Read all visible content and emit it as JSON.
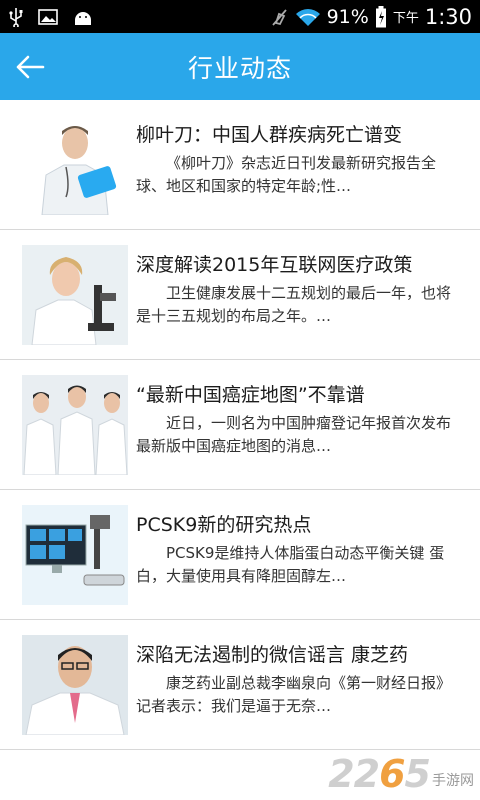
{
  "status_bar": {
    "battery_percent": "91%",
    "period": "下午",
    "time": "1:30",
    "icons": [
      "usb-icon",
      "image-icon",
      "android-icon",
      "mute-icon",
      "wifi-icon",
      "battery-icon"
    ]
  },
  "header": {
    "back_icon": "arrow-left-icon",
    "title": "行业动态"
  },
  "news": [
    {
      "title": "柳叶刀：中国人群疾病死亡谱变",
      "desc": "《柳叶刀》杂志近日刊发最新研究报告全球、地区和国家的特定年龄;性…",
      "thumb": "doctor-with-tablet"
    },
    {
      "title": "深度解读2015年互联网医疗政策",
      "desc": "卫生健康发展十二五规划的最后一年，也将是十三五规划的布局之年。…",
      "thumb": "doctor-with-microscope"
    },
    {
      "title": "“最新中国癌症地图”不靠谱",
      "desc": "近日，一则名为中国肿瘤登记年报首次发布最新版中国癌症地图的消息…",
      "thumb": "medical-team"
    },
    {
      "title": "PCSK9新的研究热点",
      "desc": "PCSK9是维持人体脂蛋白动态平衡关键 蛋白，大量使用具有降胆固醇左…",
      "thumb": "lab-equipment"
    },
    {
      "title": "深陷无法遏制的微信谣言 康芝药",
      "desc": "康芝药业副总裁李幽泉向《第一财经日报》记者表示：我们是逼于无奈…",
      "thumb": "doctor-portrait"
    }
  ],
  "watermark": {
    "number_a": "22",
    "number_b": "6",
    "number_c": "5",
    "text": "手游网"
  },
  "colors": {
    "app_bar": "#2aa7ea",
    "status_bar": "#000000",
    "divider": "#d8d8d8"
  }
}
